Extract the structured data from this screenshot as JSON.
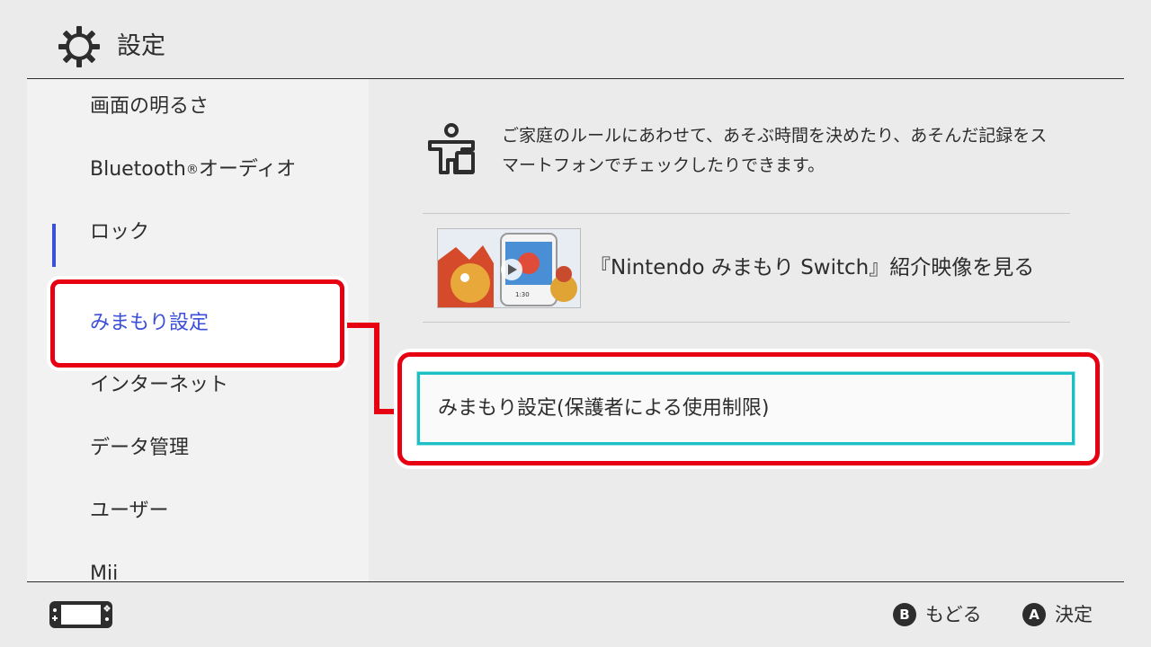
{
  "header": {
    "title": "設定",
    "icon": "gear-icon"
  },
  "sidebar": {
    "items": [
      {
        "label": "画面の明るさ"
      },
      {
        "label": "Bluetooth",
        "sup": "®",
        "suffix": "オーディオ"
      },
      {
        "label": "ロック"
      },
      {
        "label": "みまもり設定",
        "selected": true
      },
      {
        "label": "インターネット"
      },
      {
        "label": "データ管理"
      },
      {
        "label": "ユーザー"
      },
      {
        "label": "Mii"
      }
    ]
  },
  "main": {
    "info_text": "ご家庭のルールにあわせて、あそぶ時間を決めたり、あそんだ記録をスマートフォンでチェックしたりできます。",
    "video_label": "『Nintendo みまもり Switch』紹介映像を見る",
    "thumb_time": "1:30",
    "option_label": "みまもり設定(保護者による使用制限)"
  },
  "footer": {
    "back": {
      "key": "B",
      "label": "もどる"
    },
    "ok": {
      "key": "A",
      "label": "決定"
    }
  },
  "colors": {
    "accent_blue": "#3b4fd8",
    "focus_cyan": "#1cbfc4",
    "annotation_red": "#e60012"
  }
}
